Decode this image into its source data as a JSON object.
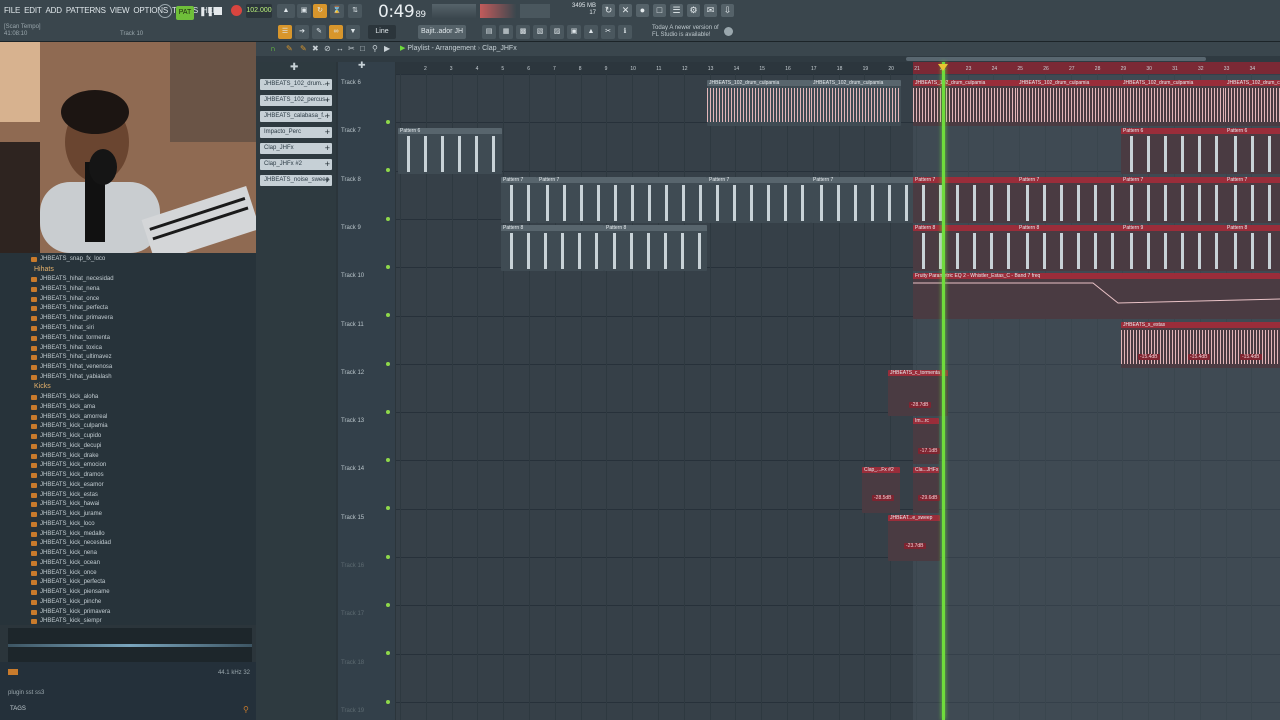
{
  "menu": [
    "FILE",
    "EDIT",
    "ADD",
    "PATTERNS",
    "VIEW",
    "OPTIONS",
    "TOOLS",
    "HELP"
  ],
  "hint": {
    "line1": "[Scan Tempo]",
    "line2": "41:08:10",
    "track": "Track 10"
  },
  "transport": {
    "tempo": "102.000",
    "time": "0:49",
    "time_small": "89",
    "mode": "Line",
    "pattern": "Bajit..ador JH",
    "mem": "3495 MB",
    "cpu": "17"
  },
  "news": {
    "line1": "Today  A newer version of",
    "line2": "FL Studio is available!"
  },
  "playlist": {
    "title": "Playlist - Arrangement",
    "crumb": "Clap_JHFx"
  },
  "channels": [
    "JHBEATS_102_drum...",
    "JHBEATS_102_percus..",
    "JHBEATS_calabasa_f..",
    "Impacto_Perc",
    "Clap_JHFx",
    "Clap_JHFx #2",
    "JHBEATS_noise_sweep"
  ],
  "browser": {
    "top": "JHBEATS_snap_fx_loco",
    "hihats_label": "Hihats",
    "hihats": [
      "JHBEATS_hihat_necesidad",
      "JHBEATS_hihat_nena",
      "JHBEATS_hihat_once",
      "JHBEATS_hihat_perfecta",
      "JHBEATS_hihat_primavera",
      "JHBEATS_hihat_siri",
      "JHBEATS_hihat_tormenta",
      "JHBEATS_hihat_toxica",
      "JHBEATS_hihat_ultimavez",
      "JHBEATS_hihat_venenosa",
      "JHBEATS_hihat_yabialash"
    ],
    "kicks_label": "Kicks",
    "kicks": [
      "JHBEATS_kick_aloha",
      "JHBEATS_kick_ama",
      "JHBEATS_kick_amorreal",
      "JHBEATS_kick_culpamia",
      "JHBEATS_kick_cupido",
      "JHBEATS_kick_decupi",
      "JHBEATS_kick_drake",
      "JHBEATS_kick_emocion",
      "JHBEATS_kick_dramos",
      "JHBEATS_kick_esamor",
      "JHBEATS_kick_estas",
      "JHBEATS_kick_hawai",
      "JHBEATS_kick_jurame",
      "JHBEATS_kick_loco",
      "JHBEATS_kick_medallo",
      "JHBEATS_kick_necesidad",
      "JHBEATS_kick_nena",
      "JHBEATS_kick_ocean",
      "JHBEATS_kick_once",
      "JHBEATS_kick_perfecta",
      "JHBEATS_kick_piensame",
      "JHBEATS_kick_pinche",
      "JHBEATS_kick_primavera",
      "JHBEATS_kick_siempr"
    ],
    "wave_info": "44.1 kHz 32",
    "bottom_row": "plugin  sst  ss3",
    "tags": "TAGS"
  },
  "tracks": [
    "Track 6",
    "Track 7",
    "Track 8",
    "Track 9",
    "Track 10",
    "Track 11",
    "Track 12",
    "Track 13",
    "Track 14",
    "Track 15",
    "Track 16",
    "Track 17",
    "Track 18",
    "Track 19"
  ],
  "ruler": [
    "2",
    "3",
    "4",
    "5",
    "6",
    "7",
    "8",
    "9",
    "10",
    "11",
    "12",
    "13",
    "14",
    "15",
    "16",
    "17",
    "18",
    "19",
    "20",
    "21",
    "22",
    "23",
    "24",
    "25",
    "26",
    "27",
    "28",
    "29",
    "30",
    "31",
    "32",
    "33",
    "34"
  ],
  "clips": {
    "drum": "JHBEATS_102_drum_culpamia",
    "p6": "Pattern 6",
    "p7": "Pattern 7",
    "p8": "Pattern 8",
    "p9": "Pattern 9",
    "automation": "Fruity Parametric EQ 2 - Whistler_Estas_C - Band 7 freq",
    "estas": "JHBEATS_s_estas",
    "tormenta": "JHBEATS_c_tormenta",
    "im": "Im...rc",
    "clap": "Clap_...Fx #2",
    "cla": "Cla...JHFx",
    "sweep": "JHBEAT...e_sweep",
    "g1": "-15.4dB",
    "g2": "-28.7dB",
    "g3": "-17.1dB",
    "g4": "-28.5dB",
    "g5": "-29.6dB",
    "g6": "-23.7dB"
  },
  "colors": {
    "accent_red": "#9a2d3a",
    "playhead": "#6fdc3c",
    "bg": "#364048"
  }
}
